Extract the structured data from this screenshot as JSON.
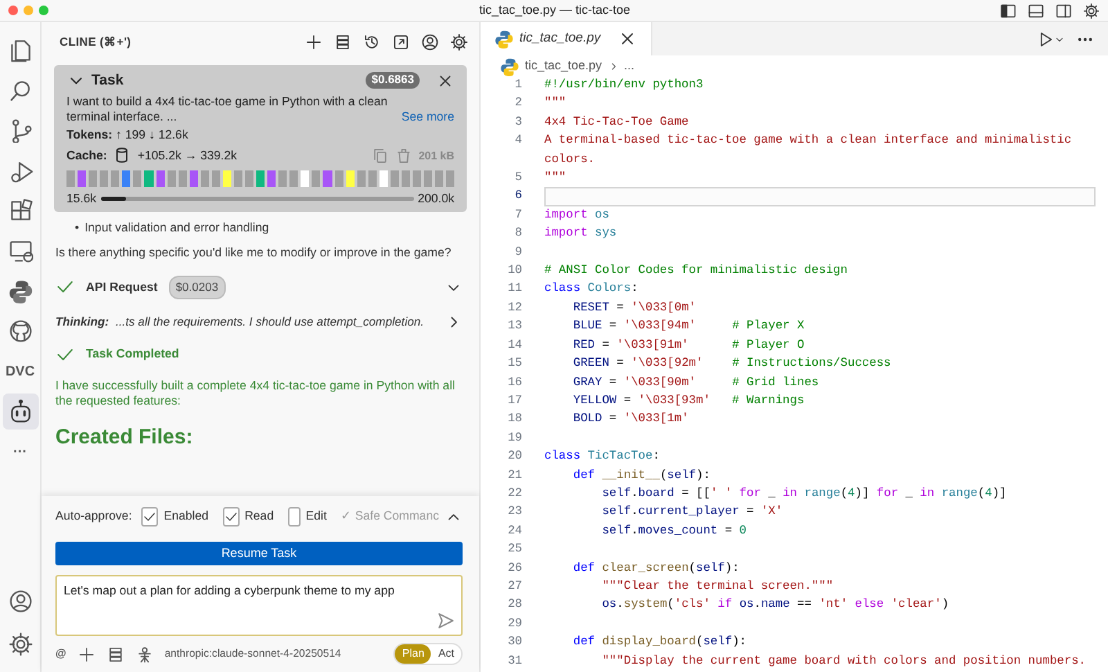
{
  "window": {
    "title": "tic_tac_toe.py — tic-tac-toe",
    "controls": [
      {
        "kind": "layout-left"
      },
      {
        "kind": "layout-bottom"
      },
      {
        "kind": "layout-split"
      },
      {
        "kind": "settings"
      }
    ]
  },
  "activity_bar": {
    "items": [
      {
        "kind": "files",
        "selected": false
      },
      {
        "kind": "search",
        "selected": false
      },
      {
        "kind": "branch",
        "selected": false
      },
      {
        "kind": "debug",
        "selected": false
      },
      {
        "kind": "extensions",
        "selected": false
      },
      {
        "kind": "remote",
        "selected": false
      },
      {
        "kind": "python",
        "selected": false
      },
      {
        "kind": "github",
        "selected": false
      },
      {
        "kind": "text",
        "label": "DVC",
        "selected": false
      },
      {
        "kind": "bot",
        "selected": true
      },
      {
        "kind": "text",
        "label": "···",
        "selected": false
      }
    ],
    "bottom": [
      {
        "kind": "account"
      },
      {
        "kind": "settings"
      }
    ]
  },
  "cline": {
    "title": "CLINE (⌘+')",
    "toolbar": [
      {
        "kind": "plus"
      },
      {
        "kind": "server"
      },
      {
        "kind": "history"
      },
      {
        "kind": "popout"
      },
      {
        "kind": "account"
      },
      {
        "kind": "settings"
      }
    ],
    "task": {
      "title": "Task",
      "cost": "$0.6863",
      "text": "I want to build a 4x4 tic-tac-toe game in Python with a clean terminal interface. ...",
      "see_more": "See more",
      "tokens": "**Tokens:** ↑ 199 ↓ 12.6k",
      "cache_label": "Cache:",
      "cache_value": "+105.2k → 339.2k",
      "size": "201 kB",
      "checkpoints": [
        {
          "color": "#a0a0a0"
        },
        {
          "color": "#a855f7"
        },
        {
          "color": "#a0a0a0"
        },
        {
          "color": "#a0a0a0"
        },
        {
          "color": "#a0a0a0"
        },
        {
          "color": "#3b82f6"
        },
        {
          "color": "#a0a0a0"
        },
        {
          "color": "#10b981"
        },
        {
          "color": "#a855f7"
        },
        {
          "color": "#a0a0a0"
        },
        {
          "color": "#a0a0a0"
        },
        {
          "color": "#a855f7"
        },
        {
          "color": "#a0a0a0"
        },
        {
          "color": "#a0a0a0"
        },
        {
          "color": "#ffff44"
        },
        {
          "color": "#a0a0a0"
        },
        {
          "color": "#a0a0a0"
        },
        {
          "color": "#10b981"
        },
        {
          "color": "#a855f7"
        },
        {
          "color": "#a0a0a0"
        },
        {
          "color": "#a0a0a0"
        },
        {
          "color": "#ffffff"
        },
        {
          "color": "#a0a0a0"
        },
        {
          "color": "#a855f7"
        },
        {
          "color": "#a0a0a0"
        },
        {
          "color": "#ffff44"
        },
        {
          "color": "#a0a0a0"
        },
        {
          "color": "#a0a0a0"
        },
        {
          "color": "#ffffff"
        },
        {
          "color": "#a0a0a0"
        },
        {
          "color": "#a0a0a0"
        },
        {
          "color": "#a0a0a0"
        },
        {
          "color": "#a0a0a0"
        },
        {
          "color": "#a0a0a0"
        },
        {
          "color": "#a0a0a0"
        }
      ],
      "context": {
        "used": "15.6k",
        "max": "200.0k",
        "level": 0.08
      }
    },
    "messages": [
      {
        "kind": "bullet",
        "marker": "•",
        "text": "Input validation and error handling"
      },
      {
        "kind": "paragraph",
        "text": "Is there anything specific you'd like me to modify or improve in the game?"
      },
      {
        "kind": "api_request",
        "title": "API Request",
        "cost": "$0.0203"
      },
      {
        "kind": "thinking",
        "text": "**Thinking:**  ...ts all the requirements. I should use attempt_completion."
      },
      {
        "kind": "completed",
        "title": "Task Completed"
      },
      {
        "kind": "success",
        "text": "I have successfully built a complete 4x4 tic-tac-toe game in Python with all the requested features:"
      },
      {
        "kind": "heading",
        "text": "Created Files:"
      }
    ],
    "auto_approve": {
      "label": "Auto-approve:",
      "options": [
        {
          "label": "Enabled",
          "checked": true
        },
        {
          "label": "Read",
          "checked": true
        },
        {
          "label": "Edit",
          "checked": false
        }
      ],
      "more": "✓ Safe Commanc"
    },
    "resume_button": "Resume Task",
    "input": {
      "value": "Let's map out a plan for adding a cyberpunk theme to my app"
    },
    "footer": {
      "at": "@",
      "model": "anthropic:claude-sonnet-4-20250514",
      "modes": [
        {
          "label": "Plan",
          "selected": true
        },
        {
          "label": "Act",
          "selected": false
        }
      ]
    }
  },
  "editor": {
    "tabs": [
      {
        "label": "tic_tac_toe.py",
        "selected": true
      }
    ],
    "breadcrumb": {
      "file": "tic_tac_toe.py",
      "rest": "..."
    },
    "lines": [
      {
        "number": "1",
        "current": false,
        "tokens": [
          {
            "kind": "comment",
            "text": "#!/usr/bin/env python3"
          }
        ]
      },
      {
        "number": "2",
        "current": false,
        "tokens": [
          {
            "kind": "string",
            "text": "\"\"\""
          }
        ]
      },
      {
        "number": "3",
        "current": false,
        "tokens": [
          {
            "kind": "string",
            "text": "4x4 Tic-Tac-Toe Game"
          }
        ]
      },
      {
        "number": "4",
        "current": false,
        "tokens": [
          {
            "kind": "string",
            "text": "A terminal-based tic-tac-toe game with a clean interface and minimalistic colors."
          }
        ]
      },
      {
        "number": "5",
        "current": false,
        "tokens": [
          {
            "kind": "string",
            "text": "\"\"\""
          }
        ]
      },
      {
        "number": "6",
        "current": true
      },
      {
        "number": "7",
        "current": false,
        "tokens": [
          {
            "kind": "keyword",
            "text": "import "
          },
          {
            "kind": "type",
            "text": "os"
          }
        ]
      },
      {
        "number": "8",
        "current": false,
        "tokens": [
          {
            "kind": "keyword",
            "text": "import "
          },
          {
            "kind": "type",
            "text": "sys"
          }
        ]
      },
      {
        "number": "9",
        "current": false
      },
      {
        "number": "10",
        "current": false,
        "tokens": [
          {
            "kind": "comment",
            "text": "# ANSI Color Codes for minimalistic design"
          }
        ]
      },
      {
        "number": "11",
        "current": false,
        "tokens": [
          {
            "kind": "def",
            "text": "class "
          },
          {
            "kind": "type",
            "text": "Colors"
          },
          {
            "kind": "plain",
            "text": ":"
          }
        ]
      },
      {
        "number": "12",
        "current": false,
        "tokens": [
          {
            "kind": "variable",
            "text": "    RESET"
          },
          {
            "kind": "plain",
            "text": " = "
          },
          {
            "kind": "string",
            "text": "'\\033[0m'"
          }
        ]
      },
      {
        "number": "13",
        "current": false,
        "tokens": [
          {
            "kind": "variable",
            "text": "    BLUE"
          },
          {
            "kind": "plain",
            "text": " = "
          },
          {
            "kind": "string",
            "text": "'\\033[94m'"
          },
          {
            "kind": "comment",
            "text": "     # Player X"
          }
        ]
      },
      {
        "number": "14",
        "current": false,
        "tokens": [
          {
            "kind": "variable",
            "text": "    RED"
          },
          {
            "kind": "plain",
            "text": " = "
          },
          {
            "kind": "string",
            "text": "'\\033[91m'"
          },
          {
            "kind": "comment",
            "text": "      # Player O"
          }
        ]
      },
      {
        "number": "15",
        "current": false,
        "tokens": [
          {
            "kind": "variable",
            "text": "    GREEN"
          },
          {
            "kind": "plain",
            "text": " = "
          },
          {
            "kind": "string",
            "text": "'\\033[92m'"
          },
          {
            "kind": "comment",
            "text": "    # Instructions/Success"
          }
        ]
      },
      {
        "number": "16",
        "current": false,
        "tokens": [
          {
            "kind": "variable",
            "text": "    GRAY"
          },
          {
            "kind": "plain",
            "text": " = "
          },
          {
            "kind": "string",
            "text": "'\\033[90m'"
          },
          {
            "kind": "comment",
            "text": "     # Grid lines"
          }
        ]
      },
      {
        "number": "17",
        "current": false,
        "tokens": [
          {
            "kind": "variable",
            "text": "    YELLOW"
          },
          {
            "kind": "plain",
            "text": " = "
          },
          {
            "kind": "string",
            "text": "'\\033[93m'"
          },
          {
            "kind": "comment",
            "text": "   # Warnings"
          }
        ]
      },
      {
        "number": "18",
        "current": false,
        "tokens": [
          {
            "kind": "variable",
            "text": "    BOLD"
          },
          {
            "kind": "plain",
            "text": " = "
          },
          {
            "kind": "string",
            "text": "'\\033[1m'"
          }
        ]
      },
      {
        "number": "19",
        "current": false
      },
      {
        "number": "20",
        "current": false,
        "tokens": [
          {
            "kind": "def",
            "text": "class "
          },
          {
            "kind": "type",
            "text": "TicTacToe"
          },
          {
            "kind": "plain",
            "text": ":"
          }
        ]
      },
      {
        "number": "21",
        "current": false,
        "tokens": [
          {
            "kind": "def",
            "text": "    def "
          },
          {
            "kind": "function",
            "text": "__init__"
          },
          {
            "kind": "plain",
            "text": "("
          },
          {
            "kind": "variable",
            "text": "self"
          },
          {
            "kind": "plain",
            "text": "):"
          }
        ]
      },
      {
        "number": "22",
        "current": false,
        "tokens": [
          {
            "kind": "variable",
            "text": "        self"
          },
          {
            "kind": "plain",
            "text": "."
          },
          {
            "kind": "variable",
            "text": "board"
          },
          {
            "kind": "plain",
            "text": " = [["
          },
          {
            "kind": "string",
            "text": "' '"
          },
          {
            "kind": "keyword",
            "text": " for"
          },
          {
            "kind": "plain",
            "text": " _ "
          },
          {
            "kind": "keyword",
            "text": "in "
          },
          {
            "kind": "type",
            "text": "range"
          },
          {
            "kind": "plain",
            "text": "("
          },
          {
            "kind": "number",
            "text": "4"
          },
          {
            "kind": "plain",
            "text": ")] "
          },
          {
            "kind": "keyword",
            "text": "for"
          },
          {
            "kind": "plain",
            "text": " _ "
          },
          {
            "kind": "keyword",
            "text": "in "
          },
          {
            "kind": "type",
            "text": "range"
          },
          {
            "kind": "plain",
            "text": "("
          },
          {
            "kind": "number",
            "text": "4"
          },
          {
            "kind": "plain",
            "text": ")]"
          }
        ]
      },
      {
        "number": "23",
        "current": false,
        "tokens": [
          {
            "kind": "variable",
            "text": "        self"
          },
          {
            "kind": "plain",
            "text": "."
          },
          {
            "kind": "variable",
            "text": "current_player"
          },
          {
            "kind": "plain",
            "text": " = "
          },
          {
            "kind": "string",
            "text": "'X'"
          }
        ]
      },
      {
        "number": "24",
        "current": false,
        "tokens": [
          {
            "kind": "variable",
            "text": "        self"
          },
          {
            "kind": "plain",
            "text": "."
          },
          {
            "kind": "variable",
            "text": "moves_count"
          },
          {
            "kind": "plain",
            "text": " = "
          },
          {
            "kind": "number",
            "text": "0"
          }
        ]
      },
      {
        "number": "25",
        "current": false
      },
      {
        "number": "26",
        "current": false,
        "tokens": [
          {
            "kind": "def",
            "text": "    def "
          },
          {
            "kind": "function",
            "text": "clear_screen"
          },
          {
            "kind": "plain",
            "text": "("
          },
          {
            "kind": "variable",
            "text": "self"
          },
          {
            "kind": "plain",
            "text": "):"
          }
        ]
      },
      {
        "number": "27",
        "current": false,
        "tokens": [
          {
            "kind": "string",
            "text": "        \"\"\"Clear the terminal screen.\"\"\""
          }
        ]
      },
      {
        "number": "28",
        "current": false,
        "tokens": [
          {
            "kind": "variable",
            "text": "        os"
          },
          {
            "kind": "plain",
            "text": "."
          },
          {
            "kind": "function",
            "text": "system"
          },
          {
            "kind": "plain",
            "text": "("
          },
          {
            "kind": "string",
            "text": "'cls'"
          },
          {
            "kind": "keyword",
            "text": " if "
          },
          {
            "kind": "variable",
            "text": "os"
          },
          {
            "kind": "plain",
            "text": "."
          },
          {
            "kind": "variable",
            "text": "name"
          },
          {
            "kind": "plain",
            "text": " == "
          },
          {
            "kind": "string",
            "text": "'nt'"
          },
          {
            "kind": "keyword",
            "text": " else "
          },
          {
            "kind": "string",
            "text": "'clear'"
          },
          {
            "kind": "plain",
            "text": ")"
          }
        ]
      },
      {
        "number": "29",
        "current": false
      },
      {
        "number": "30",
        "current": false,
        "tokens": [
          {
            "kind": "def",
            "text": "    def "
          },
          {
            "kind": "function",
            "text": "display_board"
          },
          {
            "kind": "plain",
            "text": "("
          },
          {
            "kind": "variable",
            "text": "self"
          },
          {
            "kind": "plain",
            "text": "):"
          }
        ]
      },
      {
        "number": "31",
        "current": false,
        "tokens": [
          {
            "kind": "string",
            "text": "        \"\"\"Display the current game board with colors and position numbers."
          }
        ]
      }
    ]
  }
}
